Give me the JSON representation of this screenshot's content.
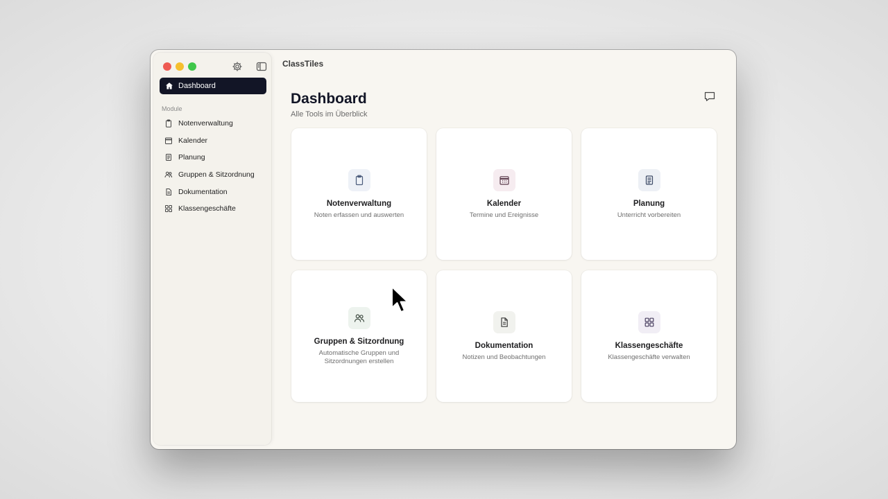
{
  "app": {
    "title": "ClassTiles"
  },
  "sidebar": {
    "active_item": {
      "label": "Dashboard",
      "icon": "home-icon"
    },
    "section_label": "Module",
    "items": [
      {
        "label": "Notenverwaltung",
        "icon": "clipboard-icon"
      },
      {
        "label": "Kalender",
        "icon": "calendar-icon"
      },
      {
        "label": "Planung",
        "icon": "document-lines-icon"
      },
      {
        "label": "Gruppen & Sitzordnung",
        "icon": "people-icon"
      },
      {
        "label": "Dokumentation",
        "icon": "file-icon"
      },
      {
        "label": "Klassengeschäfte",
        "icon": "grid-icon"
      }
    ]
  },
  "main": {
    "title": "Dashboard",
    "subtitle": "Alle Tools im Überblick",
    "cards": [
      {
        "title": "Notenverwaltung",
        "description": "Noten erfassen und auswerten",
        "icon": "clipboard-icon",
        "icon_bg": "#eef1f7",
        "icon_color": "#4a5a7a"
      },
      {
        "title": "Kalender",
        "description": "Termine und Ereignisse",
        "icon": "calendar-icon",
        "icon_bg": "#f6ecf0",
        "icon_color": "#5a3a4a"
      },
      {
        "title": "Planung",
        "description": "Unterricht vorbereiten",
        "icon": "document-lines-icon",
        "icon_bg": "#edf0f5",
        "icon_color": "#3d4a66"
      },
      {
        "title": "Gruppen & Sitzordnung",
        "description": "Automatische Gruppen und Sitzordnungen erstellen",
        "icon": "people-icon",
        "icon_bg": "#edf3ee",
        "icon_color": "#3d4a40"
      },
      {
        "title": "Dokumentation",
        "description": "Notizen und Beobachtungen",
        "icon": "file-icon",
        "icon_bg": "#f1f2ee",
        "icon_color": "#3d3d3d"
      },
      {
        "title": "Klassengeschäfte",
        "description": "Klassengeschäfte verwalten",
        "icon": "grid-icon",
        "icon_bg": "#f1eef5",
        "icon_color": "#4a4060"
      }
    ]
  },
  "colors": {
    "sidebar_active": "#121526",
    "window_bg": "#f8f6f1",
    "card_bg": "#ffffff"
  }
}
